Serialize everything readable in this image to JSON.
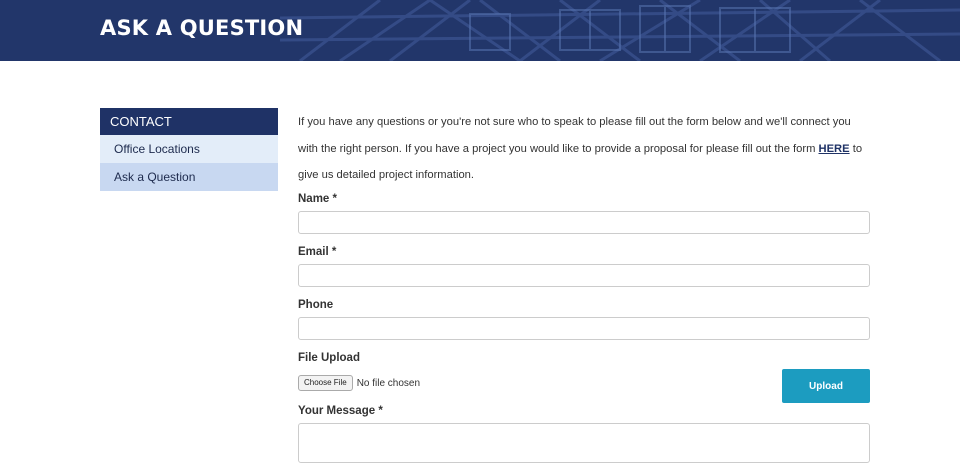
{
  "header": {
    "title": "ASK A QUESTION"
  },
  "sidebar": {
    "heading": "CONTACT",
    "items": [
      {
        "label": "Office Locations",
        "active": false
      },
      {
        "label": "Ask a Question",
        "active": true
      }
    ]
  },
  "intro": {
    "text_before_link": "If you have any questions or you're not sure who to speak to please fill out the form below and we'll connect you with the right person. If you have a project you would like to provide a proposal for please fill out the form ",
    "link_text": "HERE",
    "text_after_link": " to give us detailed project information."
  },
  "form": {
    "name_label": "Name *",
    "email_label": "Email *",
    "phone_label": "Phone",
    "file_label": "File Upload",
    "choose_file_label": "Choose File",
    "file_status": "No file chosen",
    "upload_label": "Upload",
    "message_label": "Your Message *"
  },
  "colors": {
    "header_bg": "#22366a",
    "sidebar_heading_bg": "#1f3266",
    "sidebar_item_bg": "#e3edf9",
    "sidebar_active_bg": "#c8d8f1",
    "upload_button": "#1c9cc0"
  }
}
